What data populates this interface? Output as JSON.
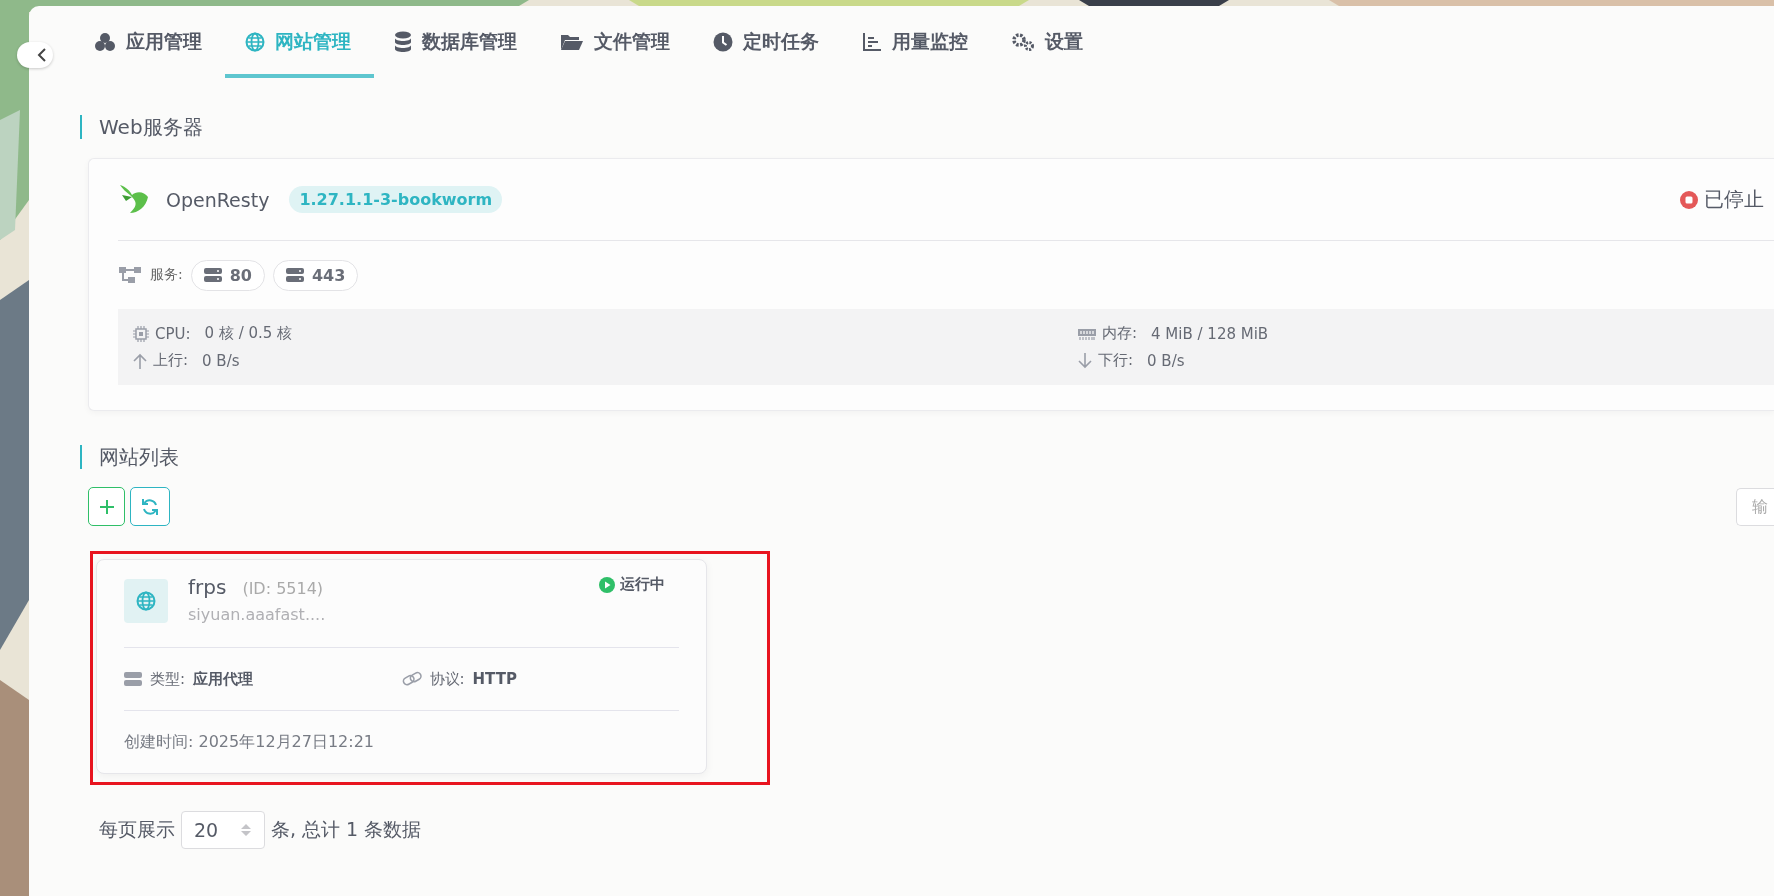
{
  "tabs": [
    {
      "label": "应用管理",
      "selected": false
    },
    {
      "label": "网站管理",
      "selected": true
    },
    {
      "label": "数据库管理",
      "selected": false
    },
    {
      "label": "文件管理",
      "selected": false
    },
    {
      "label": "定时任务",
      "selected": false
    },
    {
      "label": "用量监控",
      "selected": false
    },
    {
      "label": "设置",
      "selected": false
    }
  ],
  "web_server": {
    "section_title": "Web服务器",
    "name": "OpenResty",
    "version": "1.27.1.1-3-bookworm",
    "status": {
      "label": "已停止",
      "running": false
    },
    "services_label": "服务:",
    "ports": [
      "80",
      "443"
    ],
    "stats": [
      {
        "label": "CPU:",
        "value": "0 核 / 0.5 核"
      },
      {
        "label": "内存:",
        "value": "4 MiB / 128 MiB"
      },
      {
        "label": "上行:",
        "value": "0 B/s"
      },
      {
        "label": "下行:",
        "value": "0 B/s"
      }
    ]
  },
  "site_list": {
    "section_title": "网站列表",
    "search": {
      "placeholder": "输"
    },
    "sites": [
      {
        "name": "frps",
        "id": "(ID: 5514)",
        "domain": "siyuan.aaafast....",
        "status": {
          "label": "运行中",
          "running": true
        },
        "type_label": "类型:",
        "type": "应用代理",
        "protocol_label": "协议:",
        "protocol": "HTTP",
        "created": "创建时间: 2025年12月27日12:21",
        "highlighted": true
      }
    ]
  },
  "pagination": {
    "prefix": "每页展示",
    "page_size": "20",
    "summary": "条, 总计 1 条数据"
  }
}
